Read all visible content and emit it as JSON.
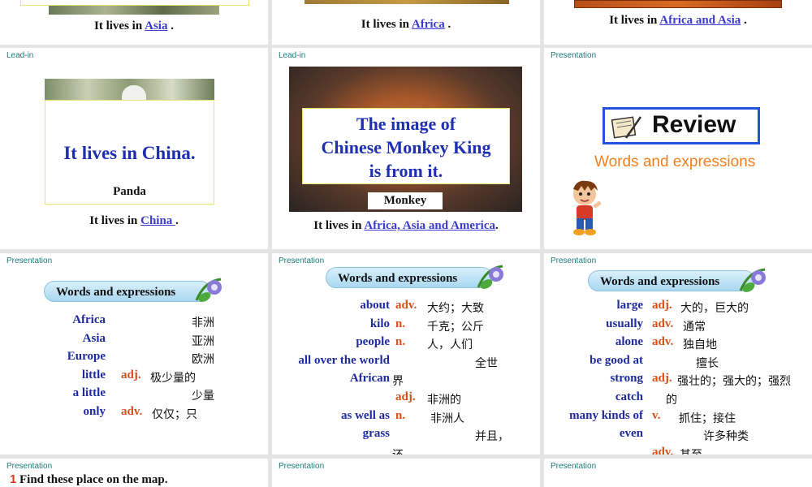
{
  "top_row": [
    {
      "prefix": "It lives in ",
      "place": "Asia",
      "suffix": " ."
    },
    {
      "prefix": "It lives in ",
      "place": "Africa",
      "suffix": " ."
    },
    {
      "prefix": "It lives in ",
      "place": "Africa and Asia",
      "suffix": " ."
    }
  ],
  "slide_panda": {
    "tag": "Lead-in",
    "headline": "It lives in China.",
    "animal": "Panda",
    "prefix": "It lives in ",
    "place": "China ",
    "suffix": " ."
  },
  "slide_monkey": {
    "tag": "Lead-in",
    "line1": "The image of",
    "line2": "Chinese Monkey King",
    "line3": "is from it.",
    "animal": "Monkey",
    "prefix": "It lives in ",
    "place": "Africa, Asia and America",
    "suffix": "."
  },
  "slide_review": {
    "tag": "Presentation",
    "title": "Review",
    "subtitle": "Words and expressions"
  },
  "vocab1": {
    "tag": "Presentation",
    "heading": "Words and expressions",
    "rows": [
      {
        "en": "Africa",
        "pos": "",
        "zh": "非洲"
      },
      {
        "en": "Asia",
        "pos": "",
        "zh": "亚洲"
      },
      {
        "en": "Europe",
        "pos": "",
        "zh": "欧洲"
      },
      {
        "en": "little",
        "pos": "adj.",
        "zh": "极少量的"
      },
      {
        "en": "a little",
        "pos": "",
        "zh": "少量"
      },
      {
        "en": "only",
        "pos": "adv.",
        "zh": "仅仅；只"
      }
    ]
  },
  "vocab2": {
    "tag": "Presentation",
    "heading": "Words and expressions",
    "rows": [
      {
        "en": "about",
        "pos": "adv.",
        "zh": "大约；大致"
      },
      {
        "en": "kilo",
        "pos": "n.",
        "zh": "千克；公斤"
      },
      {
        "en": "people",
        "pos": "n.",
        "zh": "人，人们"
      },
      {
        "en": "all over the world",
        "pos": "",
        "zh": "全世"
      },
      {
        "en": "African",
        "pos": "",
        "zh": "界"
      },
      {
        "en": "",
        "pos": "adj.",
        "zh": "非洲的"
      },
      {
        "en": "as well as",
        "pos": "n.",
        "zh": "非洲人"
      },
      {
        "en": "grass",
        "pos": "",
        "zh": "并且，"
      },
      {
        "en": "",
        "pos": "",
        "zh": "还"
      }
    ]
  },
  "vocab3": {
    "tag": "Presentation",
    "heading": "Words and expressions",
    "rows": [
      {
        "en": "large",
        "pos": "adj.",
        "zh": "大的，巨大的"
      },
      {
        "en": "usually",
        "pos": "adv.",
        "zh": "通常"
      },
      {
        "en": "alone",
        "pos": "adv.",
        "zh": "独自地"
      },
      {
        "en": "be good at",
        "pos": "",
        "zh": "擅长"
      },
      {
        "en": "strong",
        "pos": "adj.",
        "zh": "强壮的；强大的；强烈"
      },
      {
        "en": "catch",
        "pos": "",
        "zh": "的"
      },
      {
        "en": "many kinds of",
        "pos": "v.",
        "zh": "抓住；接住"
      },
      {
        "en": "even",
        "pos": "",
        "zh": "许多种类"
      },
      {
        "en": "",
        "pos": "adv.",
        "zh": "甚至"
      }
    ]
  },
  "bottom_row": [
    {
      "tag": "Presentation",
      "num": "1",
      "text": "Find these place on the map."
    },
    {
      "tag": "Presentation"
    },
    {
      "tag": "Presentation"
    }
  ]
}
